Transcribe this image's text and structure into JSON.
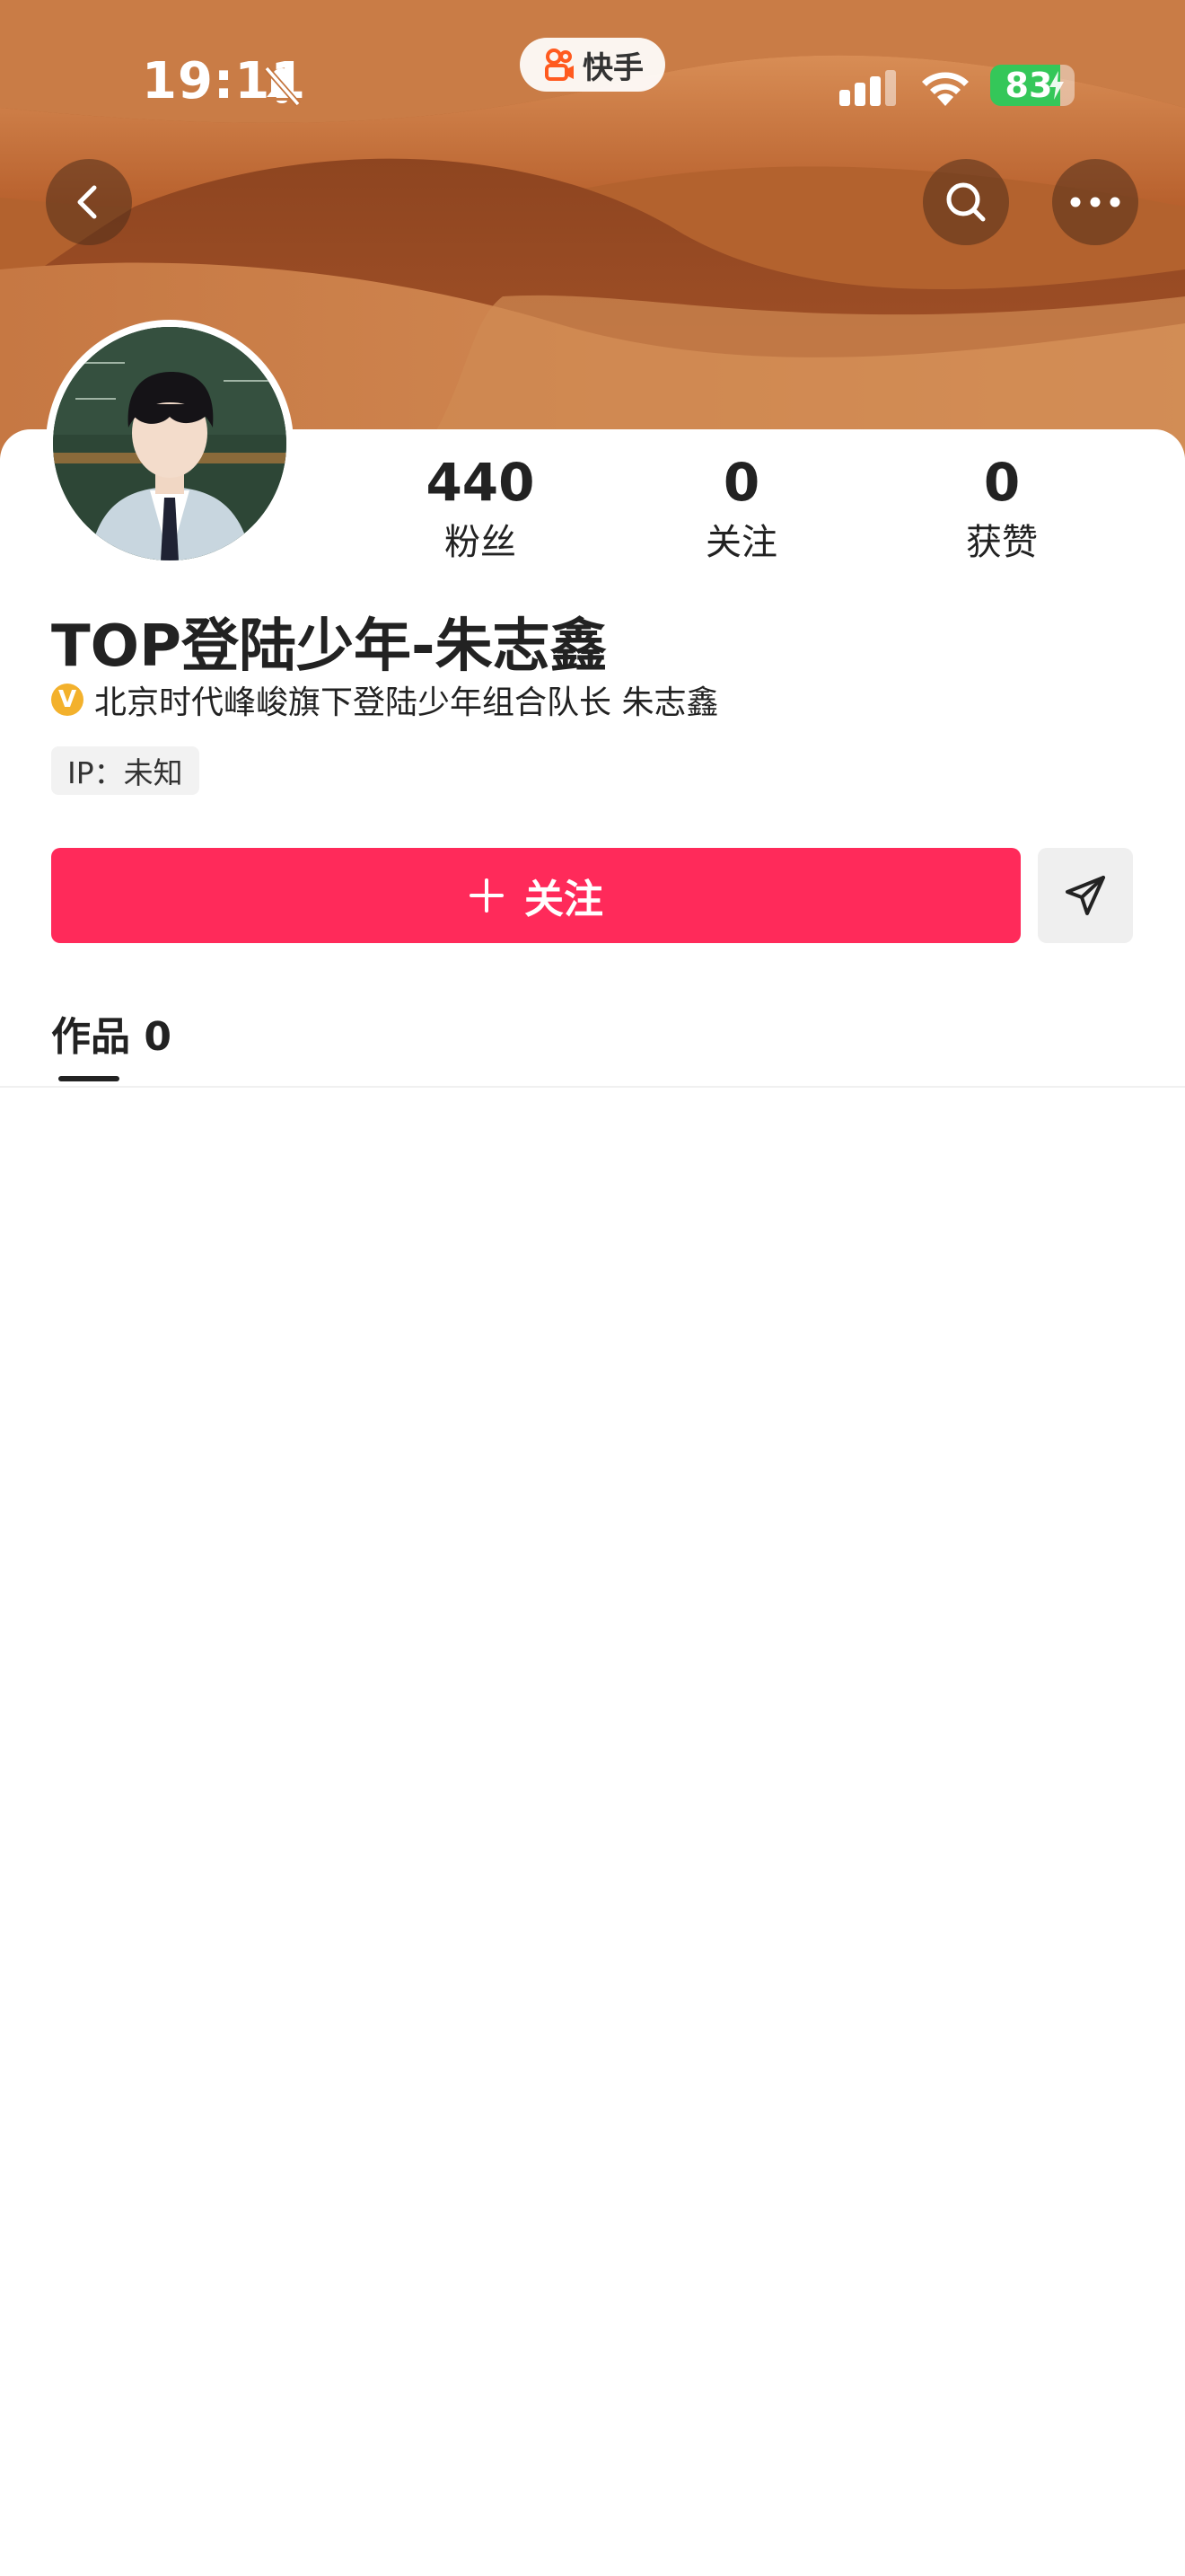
{
  "status_bar": {
    "time": "19:11",
    "battery": "83",
    "app_name": "快手"
  },
  "profile": {
    "name": "TOP登陆少年-朱志鑫",
    "verified_badge": "V",
    "verified_text": "北京时代峰峻旗下登陆少年组合队长 朱志鑫",
    "ip_label": "IP：未知"
  },
  "stats": [
    {
      "value": "440",
      "label": "粉丝"
    },
    {
      "value": "0",
      "label": "关注"
    },
    {
      "value": "0",
      "label": "获赞"
    }
  ],
  "actions": {
    "follow_label": "关注"
  },
  "tabs": [
    {
      "label": "作品 0",
      "active": true
    }
  ],
  "colors": {
    "follow_button": "#ff2a5a",
    "verify_badge": "#f3b12c",
    "battery": "#34c759",
    "app_logo": "#ff5a1f"
  },
  "icons": {
    "back": "chevron-left-icon",
    "search": "search-icon",
    "more": "more-icon",
    "share": "send-icon",
    "follow": "plus-icon"
  }
}
